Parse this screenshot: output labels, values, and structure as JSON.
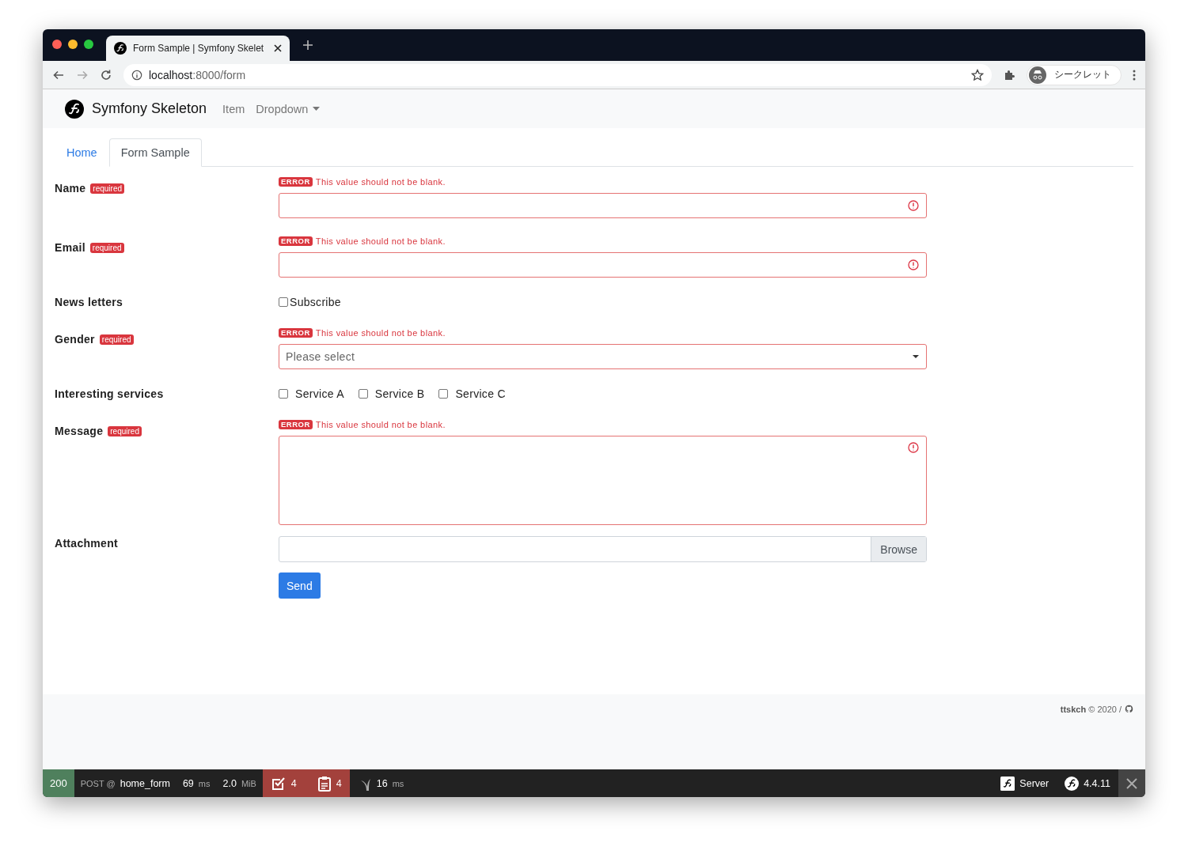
{
  "browser": {
    "tab_title": "Form Sample | Symfony Skelet",
    "url_host": "localhost",
    "url_path": ":8000/form",
    "profile": "シークレット"
  },
  "navbar": {
    "brand": "Symfony Skeleton",
    "items": [
      {
        "label": "Item",
        "kind": "link"
      },
      {
        "label": "Dropdown",
        "kind": "dropdown"
      }
    ]
  },
  "tabs": [
    {
      "label": "Home",
      "selected": false
    },
    {
      "label": "Form Sample",
      "selected": true
    }
  ],
  "form": {
    "fields": [
      {
        "label": "Name",
        "kind": "text",
        "required": "required",
        "error_badge": "ERROR",
        "error": "This value should not be blank."
      },
      {
        "label": "Email",
        "kind": "text",
        "required": "required",
        "error_badge": "ERROR",
        "error": "This value should not be blank."
      },
      {
        "label": "News letters",
        "kind": "checkbox",
        "options": [
          {
            "label": "Subscribe",
            "checked": false
          }
        ]
      },
      {
        "label": "Gender",
        "kind": "select",
        "required": "required",
        "error_badge": "ERROR",
        "error": "This value should not be blank.",
        "placeholder": "Please select"
      },
      {
        "label": "Interesting services",
        "kind": "checkboxes",
        "options": [
          {
            "label": "Service A",
            "checked": false
          },
          {
            "label": "Service B",
            "checked": false
          },
          {
            "label": "Service C",
            "checked": false
          }
        ]
      },
      {
        "label": "Message",
        "kind": "textarea",
        "required": "required",
        "error_badge": "ERROR",
        "error": "This value should not be blank."
      },
      {
        "label": "Attachment",
        "kind": "file",
        "button": "Browse"
      }
    ],
    "submit": "Send"
  },
  "footer": {
    "author": "ttskch",
    "copyright": "© 2020 /"
  },
  "debug_bar": {
    "status": "200",
    "method": "POST @",
    "route": "home_form",
    "time": "69",
    "time_unit": "ms",
    "memory": "2.0",
    "memory_unit": "MiB",
    "validator_count": "4",
    "log_count": "4",
    "render_time": "16",
    "render_unit": "ms",
    "server": "Server",
    "version": "4.4.11"
  }
}
